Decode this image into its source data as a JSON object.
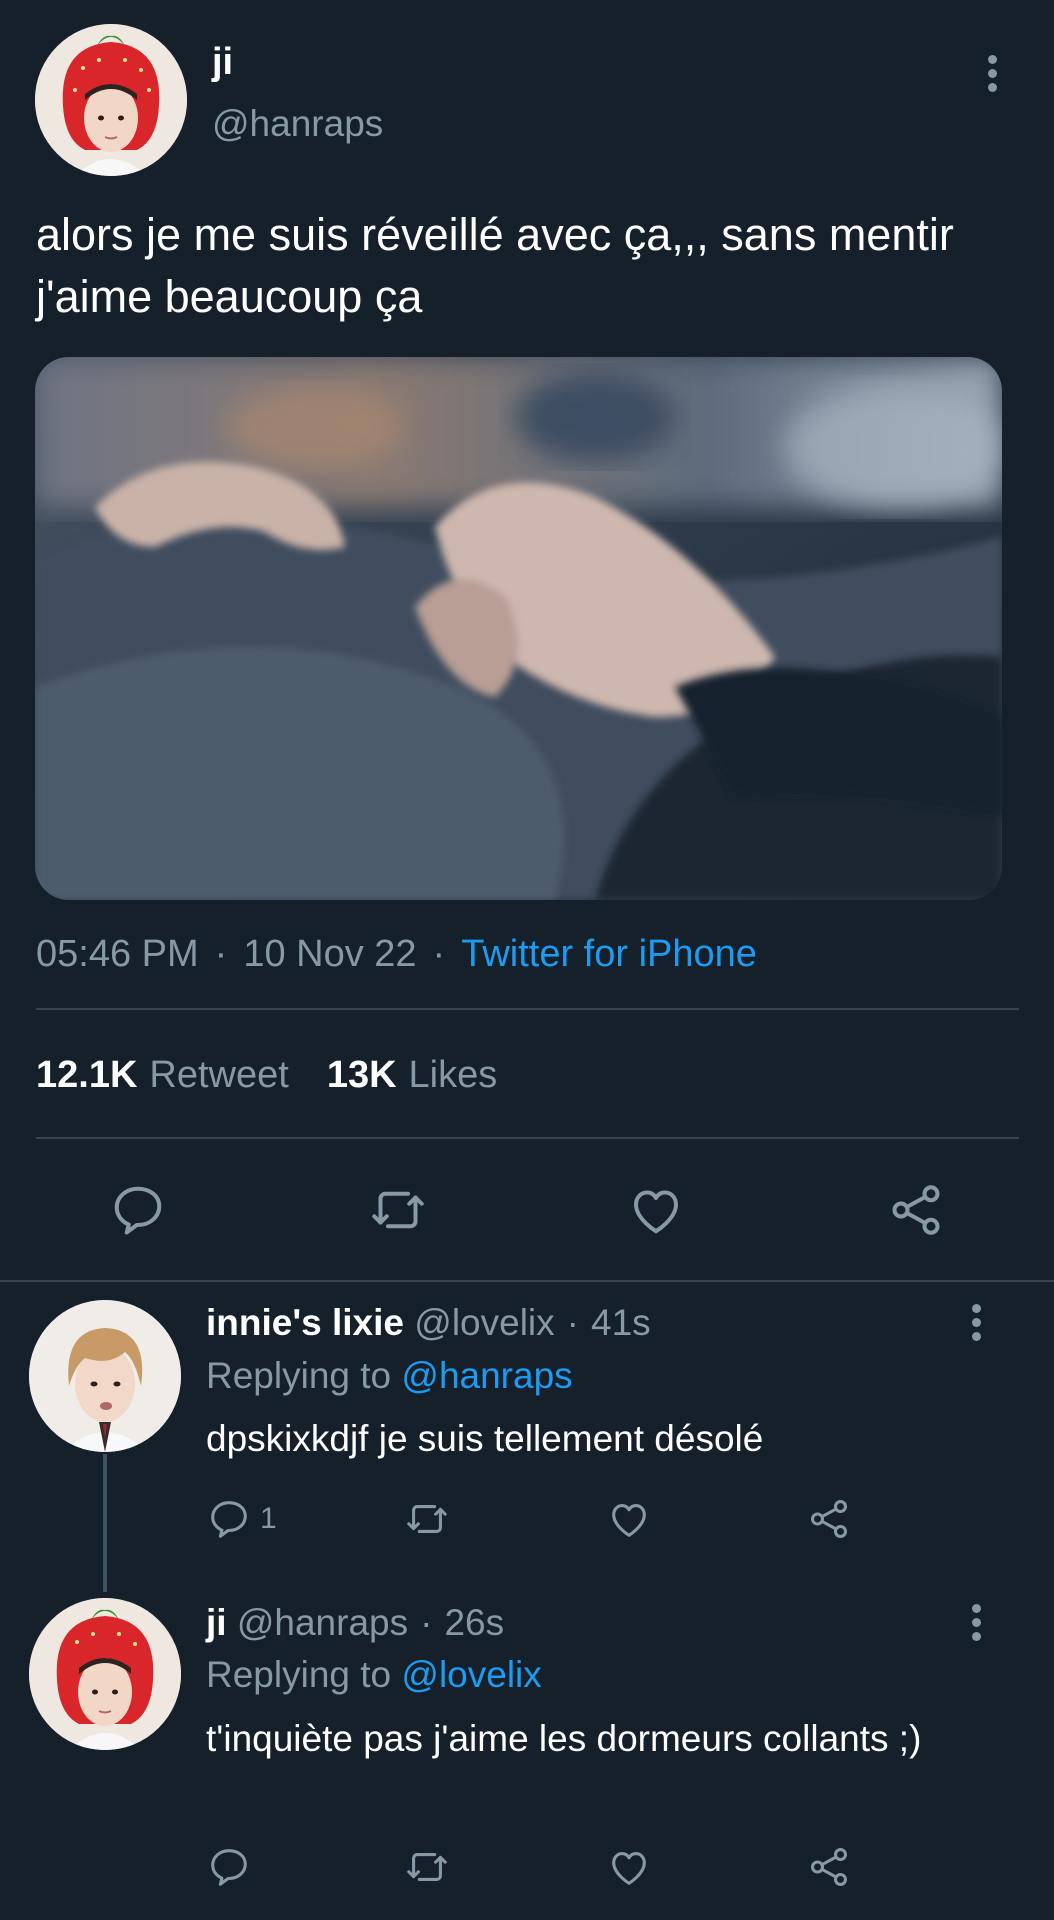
{
  "tweet": {
    "display_name": "ji",
    "handle": "@hanraps",
    "text": "alors je me suis réveillé avec ça,,, sans mentir j'aime beaucoup ça",
    "time": "05:46 PM",
    "date": "10 Nov 22",
    "source": "Twitter for iPhone",
    "retweet_count": "12.1K",
    "retweet_label": "Retweet",
    "like_count": "13K",
    "like_label": "Likes"
  },
  "replies": [
    {
      "display_name": "innie's lixie",
      "handle": "@lovelix",
      "time": "41s",
      "replying_prefix": "Replying to",
      "replying_to": "@hanraps",
      "text": "dpskixkdjf je suis tellement désolé",
      "reply_count": "1"
    },
    {
      "display_name": "ji",
      "handle": "@hanraps",
      "time": "26s",
      "replying_prefix": "Replying to",
      "replying_to": "@lovelix",
      "text": "t'inquiète pas j'aime les dormeurs collants ;)",
      "reply_count": ""
    }
  ],
  "separator": "·",
  "colors": {
    "background": "#15202b",
    "secondary_text": "#8899a6",
    "accent": "#1d9bf0",
    "divider": "#38444d"
  }
}
